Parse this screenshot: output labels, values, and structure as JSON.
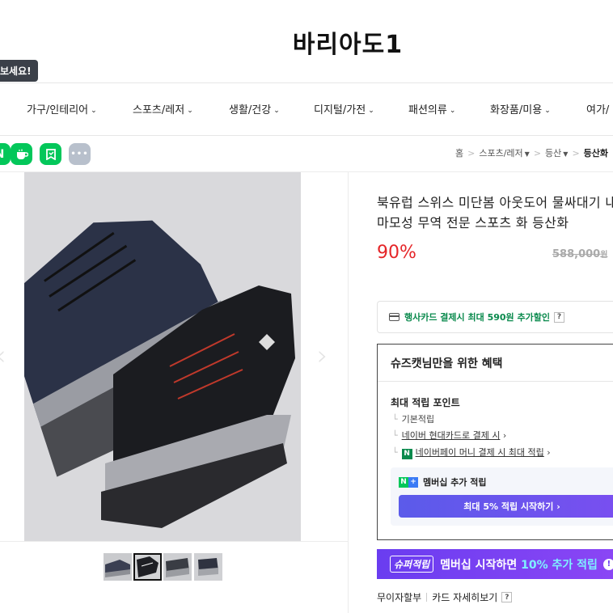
{
  "header": {
    "store_name": "바리아도1",
    "tooltip": "보세요!"
  },
  "nav": {
    "items": [
      {
        "label": "가구/인테리어"
      },
      {
        "label": "스포츠/레저"
      },
      {
        "label": "생활/건강"
      },
      {
        "label": "디지털/가전"
      },
      {
        "label": "패션의류"
      },
      {
        "label": "화장품/미용"
      },
      {
        "label": "여가/"
      }
    ]
  },
  "share": {
    "icons": [
      {
        "name": "naver-icon",
        "glyph": "N",
        "color": "#03c75a"
      },
      {
        "name": "cafe-icon",
        "glyph": "☕",
        "color": "#03c75a"
      },
      {
        "name": "blog-icon",
        "glyph": "✓",
        "color": "#03c75a"
      },
      {
        "name": "more-icon",
        "glyph": "•••",
        "color": "#b8c0cc"
      }
    ]
  },
  "breadcrumb": {
    "home": "홈",
    "level1": "스포츠/레저",
    "level2": "등산",
    "current": "등산화"
  },
  "product": {
    "title": "북유럽 스위스 미단봄 아웃도어 물싸대기 내마모성 무역 전문 스포츠 화 등산화",
    "discount": "90%",
    "original_price": "588,000",
    "currency": "원"
  },
  "card_offer": {
    "text": "행사카드 결제시 최대 590원 추가할인",
    "help": "?"
  },
  "benefit": {
    "title": "슈즈캣님만을 위한 혜택",
    "max_points_label": "최대 적립 포인트",
    "basic": "기본적립",
    "hyundai_card": "네이버 현대카드로 결제 시",
    "npay_money": "네이버페이 머니 결제 시 최대 적립",
    "membership_label": "멤버십 추가 적립",
    "membership_button": "최대 5% 적립 시작하기"
  },
  "super_banner": {
    "tag": "슈퍼적립",
    "text_before": "멤버십 시작하면 ",
    "highlight": "10% 추가 적립",
    "excl": "!"
  },
  "installment": {
    "label": "무이자할부",
    "card_detail": "카드 자세히보기",
    "help": "?"
  }
}
